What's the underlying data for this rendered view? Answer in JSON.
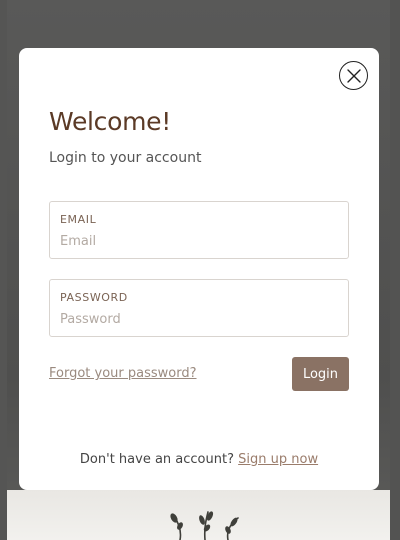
{
  "modal": {
    "title": "Welcome!",
    "subtitle": "Login to your account",
    "close_icon": "close-icon"
  },
  "form": {
    "email": {
      "label": "EMAIL",
      "placeholder": "Email",
      "value": ""
    },
    "password": {
      "label": "PASSWORD",
      "placeholder": "Password",
      "value": ""
    },
    "forgot_link": "Forgot your password?",
    "login_button": "Login"
  },
  "footer": {
    "prompt": "Don't have an account?",
    "signup_link": "Sign up now"
  },
  "colors": {
    "accent": "#8a7264",
    "title": "#5b3a26",
    "backdrop": "#5a5a58"
  }
}
